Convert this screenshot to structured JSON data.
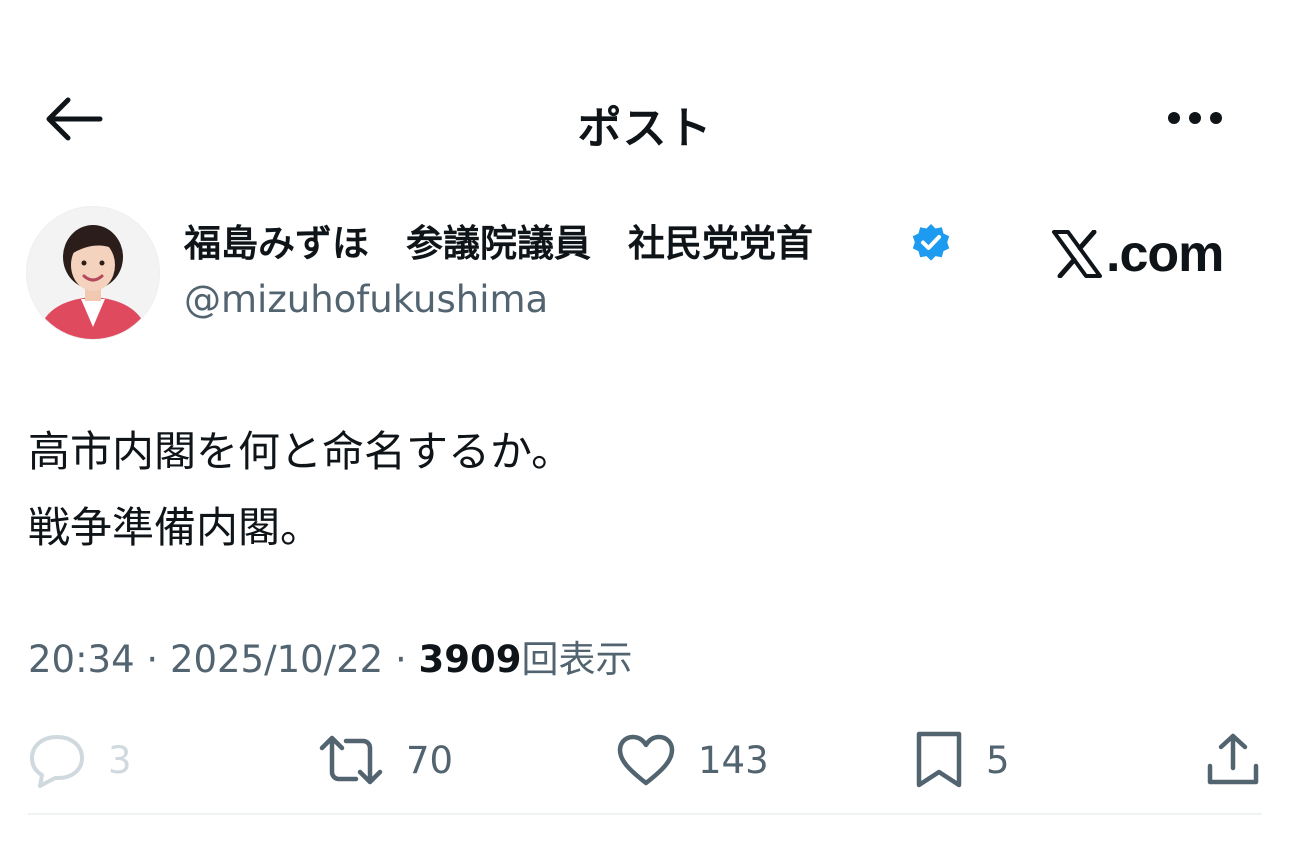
{
  "header": {
    "title": "ポスト"
  },
  "author": {
    "display_name": "福島みずほ　参議院議員　社民党党首",
    "handle": "@mizuhofukushima",
    "verified": true
  },
  "site_logo": {
    "mark": "X",
    "suffix": ".com"
  },
  "post": {
    "lines": [
      "高市内閣を何と命名するか。",
      "戦争準備内閣。"
    ]
  },
  "meta": {
    "time": "20:34",
    "separator": " · ",
    "date": "2025/10/22",
    "views_count": "3909",
    "views_label": "回表示"
  },
  "actions": {
    "replies": "3",
    "reposts": "70",
    "likes": "143",
    "bookmarks": "5"
  },
  "colors": {
    "text": "#0f1419",
    "secondary": "#536471",
    "verified": "#1d9bf0",
    "avatar_jacket": "#e04a5e"
  },
  "icons": {
    "back": "back-arrow-icon",
    "more": "more-horizontal-icon",
    "verified": "verified-badge-icon",
    "reply": "reply-icon",
    "repost": "repost-icon",
    "like": "heart-icon",
    "bookmark": "bookmark-icon",
    "share": "share-icon"
  }
}
